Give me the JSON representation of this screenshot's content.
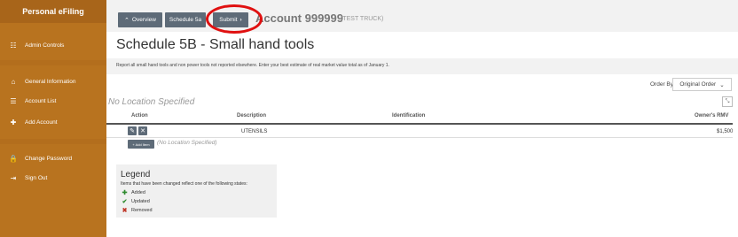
{
  "sidebar": {
    "title": "Personal eFiling",
    "items": [
      {
        "label": "Admin Controls",
        "icon": "admin-controls-icon",
        "glyph": "☷"
      },
      {
        "label": "General Information",
        "icon": "home-icon",
        "glyph": "⌂"
      },
      {
        "label": "Account List",
        "icon": "list-icon",
        "glyph": "☰"
      },
      {
        "label": "Add Account",
        "icon": "plus-icon",
        "glyph": "✚"
      },
      {
        "label": "Change Password",
        "icon": "lock-icon",
        "glyph": "🔒"
      },
      {
        "label": "Sign Out",
        "icon": "sign-out-icon",
        "glyph": "⇥"
      }
    ]
  },
  "toolbar": {
    "overview_label": "Overview",
    "schedule_label": "Schedule 5a",
    "submit_label": "Submit",
    "account_title": "Account 999999",
    "account_sub": "(TEST TRUCK)"
  },
  "page": {
    "title": "Schedule 5B - Small hand tools",
    "description": "Report all small hand tools and non power tools not reported elsewhere. Enter your best estimate of real market value total as of January 1."
  },
  "order": {
    "label": "Order By",
    "value": "Original Order"
  },
  "location": {
    "title": "No Location Specified",
    "expand_icon": "expand-icon"
  },
  "table": {
    "headers": {
      "action": "Action",
      "description": "Description",
      "identification": "Identification",
      "rmv": "Owner's RMV"
    },
    "rows": [
      {
        "description": "UTENSILS",
        "identification": "",
        "rmv": "$1,500"
      }
    ]
  },
  "add_item": {
    "label": "+ Add Item",
    "note": "(No Location Specified)"
  },
  "legend": {
    "title": "Legend",
    "subtitle": "Items that have been changed reflect one of the following states:",
    "items": [
      {
        "label": "Added",
        "glyph": "✚",
        "color": "#2e8b2e"
      },
      {
        "label": "Updated",
        "glyph": "✔",
        "color": "#2e8b2e"
      },
      {
        "label": "Removed",
        "glyph": "✖",
        "color": "#c0392b"
      }
    ]
  },
  "colors": {
    "sidebar": "#b8731f",
    "button": "#5e6b78",
    "highlight_circle": "#e01010"
  }
}
